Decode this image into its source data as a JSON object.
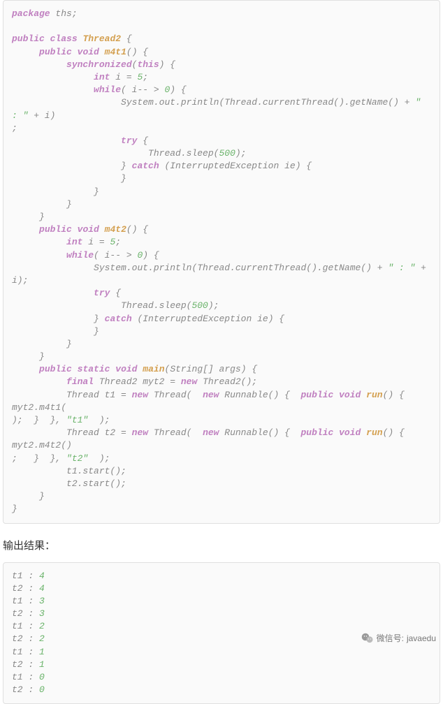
{
  "code": {
    "lines": [
      {
        "indent": 0,
        "tokens": [
          {
            "t": "kw",
            "v": "package"
          },
          {
            "t": "txt",
            "v": " ths;"
          }
        ]
      },
      {
        "indent": 0,
        "tokens": []
      },
      {
        "indent": 0,
        "tokens": [
          {
            "t": "kw",
            "v": "public"
          },
          {
            "t": "txt",
            "v": " "
          },
          {
            "t": "kw",
            "v": "class"
          },
          {
            "t": "txt",
            "v": " "
          },
          {
            "t": "cls",
            "v": "Thread2"
          },
          {
            "t": "txt",
            "v": " {"
          }
        ]
      },
      {
        "indent": 1,
        "tokens": [
          {
            "t": "kw",
            "v": "public"
          },
          {
            "t": "txt",
            "v": " "
          },
          {
            "t": "kw",
            "v": "void"
          },
          {
            "t": "txt",
            "v": " "
          },
          {
            "t": "mtd",
            "v": "m4t1"
          },
          {
            "t": "txt",
            "v": "() {"
          }
        ]
      },
      {
        "indent": 2,
        "tokens": [
          {
            "t": "kw",
            "v": "synchronized"
          },
          {
            "t": "txt",
            "v": "("
          },
          {
            "t": "kw",
            "v": "this"
          },
          {
            "t": "txt",
            "v": ") {"
          }
        ]
      },
      {
        "indent": 3,
        "tokens": [
          {
            "t": "kw",
            "v": "int"
          },
          {
            "t": "txt",
            "v": " i = "
          },
          {
            "t": "num",
            "v": "5"
          },
          {
            "t": "txt",
            "v": ";"
          }
        ]
      },
      {
        "indent": 3,
        "tokens": [
          {
            "t": "kw",
            "v": "while"
          },
          {
            "t": "txt",
            "v": "( i-- > "
          },
          {
            "t": "num",
            "v": "0"
          },
          {
            "t": "txt",
            "v": ") {"
          }
        ]
      },
      {
        "indent": 4,
        "tokens": [
          {
            "t": "txt",
            "v": "System.out.println(Thread.currentThread().getName() + "
          },
          {
            "t": "str",
            "v": "\" : \""
          },
          {
            "t": "txt",
            "v": " + i)"
          }
        ]
      },
      {
        "indent": 0,
        "tokens": [
          {
            "t": "txt",
            "v": ";"
          }
        ]
      },
      {
        "indent": 4,
        "tokens": [
          {
            "t": "kw",
            "v": "try"
          },
          {
            "t": "txt",
            "v": " {"
          }
        ]
      },
      {
        "indent": 5,
        "tokens": [
          {
            "t": "txt",
            "v": "Thread.sleep("
          },
          {
            "t": "num",
            "v": "500"
          },
          {
            "t": "txt",
            "v": ");"
          }
        ]
      },
      {
        "indent": 4,
        "tokens": [
          {
            "t": "txt",
            "v": "} "
          },
          {
            "t": "kw",
            "v": "catch"
          },
          {
            "t": "txt",
            "v": " (InterruptedException ie) {"
          }
        ]
      },
      {
        "indent": 4,
        "tokens": [
          {
            "t": "txt",
            "v": "}"
          }
        ]
      },
      {
        "indent": 3,
        "tokens": [
          {
            "t": "txt",
            "v": "}"
          }
        ]
      },
      {
        "indent": 2,
        "tokens": [
          {
            "t": "txt",
            "v": "}"
          }
        ]
      },
      {
        "indent": 1,
        "tokens": [
          {
            "t": "txt",
            "v": "}"
          }
        ]
      },
      {
        "indent": 1,
        "tokens": [
          {
            "t": "kw",
            "v": "public"
          },
          {
            "t": "txt",
            "v": " "
          },
          {
            "t": "kw",
            "v": "void"
          },
          {
            "t": "txt",
            "v": " "
          },
          {
            "t": "mtd",
            "v": "m4t2"
          },
          {
            "t": "txt",
            "v": "() {"
          }
        ]
      },
      {
        "indent": 2,
        "tokens": [
          {
            "t": "kw",
            "v": "int"
          },
          {
            "t": "txt",
            "v": " i = "
          },
          {
            "t": "num",
            "v": "5"
          },
          {
            "t": "txt",
            "v": ";"
          }
        ]
      },
      {
        "indent": 2,
        "tokens": [
          {
            "t": "kw",
            "v": "while"
          },
          {
            "t": "txt",
            "v": "( i-- > "
          },
          {
            "t": "num",
            "v": "0"
          },
          {
            "t": "txt",
            "v": ") {"
          }
        ]
      },
      {
        "indent": 3,
        "tokens": [
          {
            "t": "txt",
            "v": "System.out.println(Thread.currentThread().getName() + "
          },
          {
            "t": "str",
            "v": "\" : \""
          },
          {
            "t": "txt",
            "v": " + i);"
          }
        ]
      },
      {
        "indent": 3,
        "tokens": [
          {
            "t": "kw",
            "v": "try"
          },
          {
            "t": "txt",
            "v": " {"
          }
        ]
      },
      {
        "indent": 4,
        "tokens": [
          {
            "t": "txt",
            "v": "Thread.sleep("
          },
          {
            "t": "num",
            "v": "500"
          },
          {
            "t": "txt",
            "v": ");"
          }
        ]
      },
      {
        "indent": 3,
        "tokens": [
          {
            "t": "txt",
            "v": "} "
          },
          {
            "t": "kw",
            "v": "catch"
          },
          {
            "t": "txt",
            "v": " (InterruptedException ie) {"
          }
        ]
      },
      {
        "indent": 3,
        "tokens": [
          {
            "t": "txt",
            "v": "}"
          }
        ]
      },
      {
        "indent": 2,
        "tokens": [
          {
            "t": "txt",
            "v": "}"
          }
        ]
      },
      {
        "indent": 1,
        "tokens": [
          {
            "t": "txt",
            "v": "}"
          }
        ]
      },
      {
        "indent": 1,
        "tokens": [
          {
            "t": "kw",
            "v": "public"
          },
          {
            "t": "txt",
            "v": " "
          },
          {
            "t": "kw",
            "v": "static"
          },
          {
            "t": "txt",
            "v": " "
          },
          {
            "t": "kw",
            "v": "void"
          },
          {
            "t": "txt",
            "v": " "
          },
          {
            "t": "mtd",
            "v": "main"
          },
          {
            "t": "txt",
            "v": "(String[] args) {"
          }
        ]
      },
      {
        "indent": 2,
        "tokens": [
          {
            "t": "kw",
            "v": "final"
          },
          {
            "t": "txt",
            "v": " Thread2 myt2 = "
          },
          {
            "t": "kw",
            "v": "new"
          },
          {
            "t": "txt",
            "v": " Thread2();"
          }
        ]
      },
      {
        "indent": 2,
        "tokens": [
          {
            "t": "txt",
            "v": "Thread t1 = "
          },
          {
            "t": "kw",
            "v": "new"
          },
          {
            "t": "txt",
            "v": " Thread(  "
          },
          {
            "t": "kw",
            "v": "new"
          },
          {
            "t": "txt",
            "v": " Runnable() {  "
          },
          {
            "t": "kw",
            "v": "public"
          },
          {
            "t": "txt",
            "v": " "
          },
          {
            "t": "kw",
            "v": "void"
          },
          {
            "t": "txt",
            "v": " "
          },
          {
            "t": "mtd",
            "v": "run"
          },
          {
            "t": "txt",
            "v": "() {  myt2.m4t1("
          }
        ]
      },
      {
        "indent": 0,
        "tokens": [
          {
            "t": "txt",
            "v": ");  }  }, "
          },
          {
            "t": "str",
            "v": "\"t1\""
          },
          {
            "t": "txt",
            "v": "  );"
          }
        ]
      },
      {
        "indent": 2,
        "tokens": [
          {
            "t": "txt",
            "v": "Thread t2 = "
          },
          {
            "t": "kw",
            "v": "new"
          },
          {
            "t": "txt",
            "v": " Thread(  "
          },
          {
            "t": "kw",
            "v": "new"
          },
          {
            "t": "txt",
            "v": " Runnable() {  "
          },
          {
            "t": "kw",
            "v": "public"
          },
          {
            "t": "txt",
            "v": " "
          },
          {
            "t": "kw",
            "v": "void"
          },
          {
            "t": "txt",
            "v": " "
          },
          {
            "t": "mtd",
            "v": "run"
          },
          {
            "t": "txt",
            "v": "() { myt2.m4t2()"
          }
        ]
      },
      {
        "indent": 0,
        "tokens": [
          {
            "t": "txt",
            "v": ";   }  }, "
          },
          {
            "t": "str",
            "v": "\"t2\""
          },
          {
            "t": "txt",
            "v": "  );"
          }
        ]
      },
      {
        "indent": 2,
        "tokens": [
          {
            "t": "txt",
            "v": "t1.start();"
          }
        ]
      },
      {
        "indent": 2,
        "tokens": [
          {
            "t": "txt",
            "v": "t2.start();"
          }
        ]
      },
      {
        "indent": 1,
        "tokens": [
          {
            "t": "txt",
            "v": "}"
          }
        ]
      },
      {
        "indent": 0,
        "tokens": [
          {
            "t": "txt",
            "v": "}"
          }
        ]
      }
    ]
  },
  "output_label": "输出结果：",
  "output": {
    "lines": [
      {
        "thread": "t1",
        "value": "4"
      },
      {
        "thread": "t2",
        "value": "4"
      },
      {
        "thread": "t1",
        "value": "3"
      },
      {
        "thread": "t2",
        "value": "3"
      },
      {
        "thread": "t1",
        "value": "2"
      },
      {
        "thread": "t2",
        "value": "2"
      },
      {
        "thread": "t1",
        "value": "1"
      },
      {
        "thread": "t2",
        "value": "1"
      },
      {
        "thread": "t1",
        "value": "0"
      },
      {
        "thread": "t2",
        "value": "0"
      }
    ]
  },
  "watermark": {
    "label": "微信号:",
    "handle": "javaedu"
  }
}
